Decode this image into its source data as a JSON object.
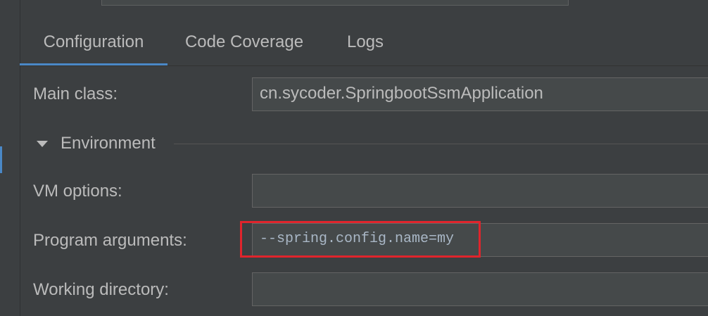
{
  "tabs": [
    {
      "label": "Configuration",
      "active": true
    },
    {
      "label": "Code Coverage",
      "active": false
    },
    {
      "label": "Logs",
      "active": false
    }
  ],
  "form": {
    "main_class_label": "Main class:",
    "main_class_value": "cn.sycoder.SpringbootSsmApplication",
    "environment_title": "Environment",
    "vm_options_label": "VM options:",
    "vm_options_value": "",
    "program_args_label": "Program arguments:",
    "program_args_value": "--spring.config.name=my",
    "working_dir_label": "Working directory:",
    "working_dir_value": ""
  },
  "colors": {
    "background": "#3c3f41",
    "accent": "#4a88c7",
    "highlight_box": "#e0242c"
  },
  "icons": {
    "environment_toggle": "triangle-down-icon"
  }
}
